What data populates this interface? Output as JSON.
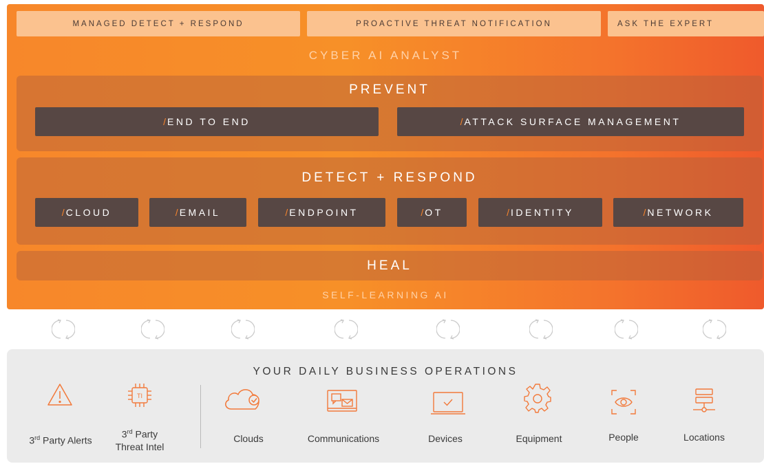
{
  "top_tabs": [
    "MANAGED DETECT + RESPOND",
    "PROACTIVE THREAT NOTIFICATION",
    "ASK THE EXPERT"
  ],
  "cyber_ai_label": "CYBER AI ANALYST",
  "prevent": {
    "title": "PREVENT",
    "items": [
      "END TO END",
      "ATTACK SURFACE MANAGEMENT"
    ]
  },
  "detect": {
    "title": "DETECT + RESPOND",
    "items": [
      "CLOUD",
      "EMAIL",
      "ENDPOINT",
      "OT",
      "IDENTITY",
      "NETWORK"
    ]
  },
  "heal": {
    "title": "HEAL"
  },
  "self_learning_label": "SELF-LEARNING AI",
  "chip_prefix": "/",
  "operations": {
    "title": "YOUR DAILY BUSINESS OPERATIONS",
    "items": [
      {
        "icon": "warning-triangle-icon",
        "label_main": "3",
        "label_sup": "rd",
        "label_rest": " Party Alerts",
        "label_line2": ""
      },
      {
        "icon": "threat-intel-chip-icon",
        "label_main": "3",
        "label_sup": "rd",
        "label_rest": " Party",
        "label_line2": "Threat Intel"
      },
      {
        "icon": "cloud-check-icon",
        "label_main": "Clouds",
        "label_sup": "",
        "label_rest": "",
        "label_line2": ""
      },
      {
        "icon": "communications-icon",
        "label_main": "Communications",
        "label_sup": "",
        "label_rest": "",
        "label_line2": ""
      },
      {
        "icon": "laptop-check-icon",
        "label_main": "Devices",
        "label_sup": "",
        "label_rest": "",
        "label_line2": ""
      },
      {
        "icon": "gear-icon",
        "label_main": "Equipment",
        "label_sup": "",
        "label_rest": "",
        "label_line2": ""
      },
      {
        "icon": "eye-scan-icon",
        "label_main": "People",
        "label_sup": "",
        "label_rest": "",
        "label_line2": ""
      },
      {
        "icon": "network-locations-icon",
        "label_main": "Locations",
        "label_sup": "",
        "label_rest": "",
        "label_line2": ""
      }
    ]
  },
  "colors": {
    "accent_orange": "#f7852d",
    "chip_brown": "#574744",
    "tab_peach": "#fbc28f",
    "ops_bg": "#ebebeb"
  }
}
